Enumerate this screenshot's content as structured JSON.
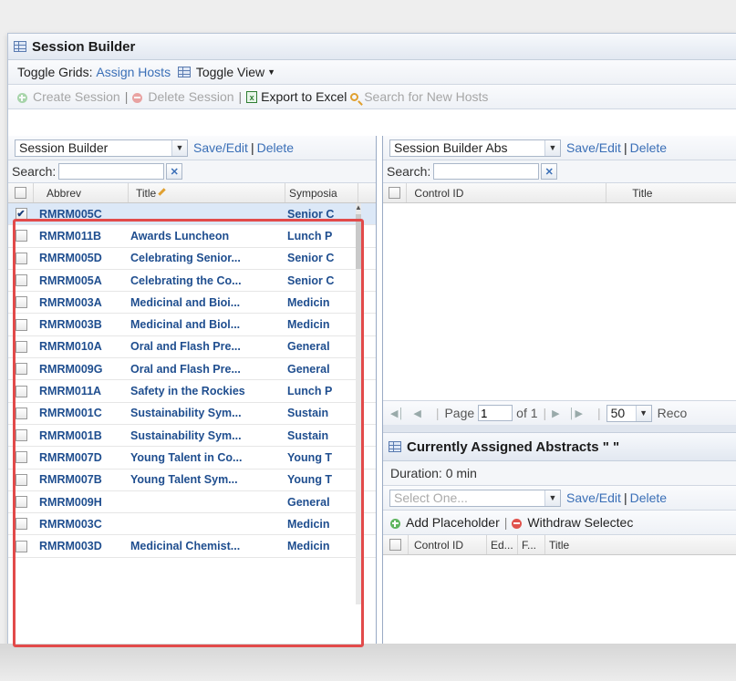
{
  "window": {
    "title": "Session Builder"
  },
  "toggle_bar": {
    "label": "Toggle Grids:",
    "assign_hosts": "Assign Hosts",
    "toggle_view": "Toggle View"
  },
  "actions": {
    "create_session": "Create Session",
    "delete_session": "Delete Session",
    "export_excel": "Export to Excel",
    "search_hosts": "Search for New Hosts",
    "separator": "|"
  },
  "left_pane": {
    "view_select": "Session Builder",
    "save_edit": "Save/Edit",
    "delete": "Delete",
    "search_label": "Search:",
    "search_value": "",
    "columns": {
      "abbrev": "Abbrev",
      "title": "Title",
      "symposia": "Symposia"
    },
    "rows": [
      {
        "abbrev": "RMRM005C",
        "title": "",
        "symposia": "Senior C",
        "checked": true
      },
      {
        "abbrev": "RMRM011B",
        "title": "Awards Luncheon",
        "symposia": "Lunch P",
        "checked": false
      },
      {
        "abbrev": "RMRM005D",
        "title": "Celebrating Senior...",
        "symposia": "Senior C",
        "checked": false
      },
      {
        "abbrev": "RMRM005A",
        "title": "Celebrating the Co...",
        "symposia": "Senior C",
        "checked": false
      },
      {
        "abbrev": "RMRM003A",
        "title": "Medicinal and Bioi...",
        "symposia": "Medicin",
        "checked": false
      },
      {
        "abbrev": "RMRM003B",
        "title": "Medicinal and Biol...",
        "symposia": "Medicin",
        "checked": false
      },
      {
        "abbrev": "RMRM010A",
        "title": "Oral and Flash Pre...",
        "symposia": "General",
        "checked": false
      },
      {
        "abbrev": "RMRM009G",
        "title": "Oral and Flash Pre...",
        "symposia": "General",
        "checked": false
      },
      {
        "abbrev": "RMRM011A",
        "title": "Safety in the Rockies",
        "symposia": "Lunch P",
        "checked": false
      },
      {
        "abbrev": "RMRM001C",
        "title": "Sustainability Sym...",
        "symposia": "Sustain",
        "checked": false
      },
      {
        "abbrev": "RMRM001B",
        "title": "Sustainability Sym...",
        "symposia": "Sustain",
        "checked": false
      },
      {
        "abbrev": "RMRM007D",
        "title": "Young Talent in Co...",
        "symposia": "Young T",
        "checked": false
      },
      {
        "abbrev": "RMRM007B",
        "title": "Young Talent Sym...",
        "symposia": "Young T",
        "checked": false
      },
      {
        "abbrev": "RMRM009H",
        "title": "",
        "symposia": "General",
        "checked": false
      },
      {
        "abbrev": "RMRM003C",
        "title": "",
        "symposia": "Medicin",
        "checked": false
      },
      {
        "abbrev": "RMRM003D",
        "title": "Medicinal Chemist...",
        "symposia": "Medicin",
        "checked": false
      }
    ]
  },
  "right_pane": {
    "view_select": "Session Builder Abs",
    "save_edit": "Save/Edit",
    "delete": "Delete",
    "search_label": "Search:",
    "search_value": "",
    "columns": {
      "control_id": "Control ID",
      "title": "Title"
    },
    "pager": {
      "page_label": "Page",
      "page_value": "1",
      "of_label": "of 1",
      "page_size": "50",
      "records_label": "Reco"
    }
  },
  "assigned": {
    "title": "Currently Assigned Abstracts \" \"",
    "duration": "Duration: 0 min",
    "select_placeholder": "Select One...",
    "save_edit": "Save/Edit",
    "delete": "Delete",
    "add_placeholder": "Add Placeholder",
    "withdraw_selected": "Withdraw Selectec",
    "columns": {
      "control_id": "Control ID",
      "ed": "Ed...",
      "f": "F...",
      "title": "Title"
    }
  },
  "colors": {
    "accent": "#3a6fb7",
    "highlight": "#e24a4a",
    "row_text": "#1f4e8f"
  }
}
